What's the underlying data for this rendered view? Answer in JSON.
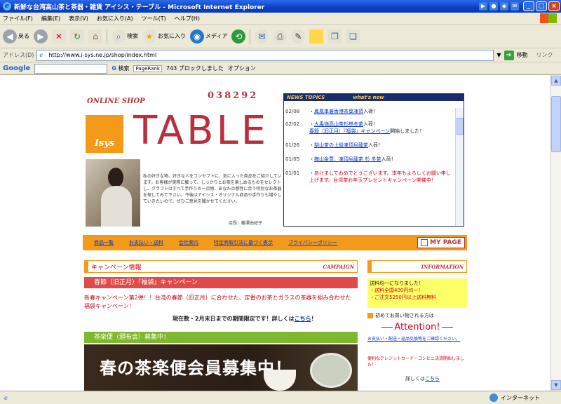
{
  "window": {
    "title": "新鮮な台湾高山茶と茶器・雑貨 アイシス・テーブル - Microsoft Internet Explorer"
  },
  "menu": [
    "ファイル(F)",
    "編集(E)",
    "表示(V)",
    "お気に入り(A)",
    "ツール(T)",
    "ヘルプ(H)"
  ],
  "toolbar": {
    "back": "戻る",
    "search": "検索",
    "favorites": "お気に入り",
    "media": "メディア"
  },
  "address": {
    "label": "アドレス(D)",
    "url": "http://www.i-sys.ne.jp/shop/index.html",
    "go": "移動",
    "links": "リンク"
  },
  "google": {
    "logo": "Google",
    "search_btn": "検索",
    "pagerank": "PageRank",
    "blocked": "743 ブロックしました",
    "options": "オプション"
  },
  "site": {
    "online_shop": "ONLINE SHOP",
    "counter": "038292",
    "logo_text": "Isys",
    "table_word": "TABLE",
    "intro": "私の好きな物、好きな人をコンセプトに、気に入った商品をご紹介しています。お客様が実際に触って、しっかりとお茶を楽しめるものをセレクトし、クラフトはすべて手作りの一点物、あなたの感性に合う特別なお茶器を探してみて下さい。今後はアイシス・オリジナル商品や手作りも増やしていきたいので、ぜひご意見を聞かせてください。",
    "sign": "店長：藤澤由紀子",
    "news_header_jp": "NEWS TOPICS",
    "news_header_en": "what's new",
    "news": [
      {
        "date": "02/08",
        "pre": "・",
        "link": "鳳凰単叢香港茶葉凍頂",
        "post": "入荷！"
      },
      {
        "date": "02/02",
        "pre": "・",
        "link": "大禹嶺高山茶杉林冬茶",
        "post": "入荷！",
        "link2": "春節（旧正月）『福袋』キャンペーン",
        "post2": "開始しました！"
      },
      {
        "date": "01/26",
        "pre": "・",
        "link": "梨山茶の上級凍頂烏龍茶",
        "post": "入荷！"
      },
      {
        "date": "01/05",
        "pre": "・",
        "link": "梅山金萱、凍頂烏龍茶 杉 冬茶",
        "post": "入荷！"
      },
      {
        "date": "01/01",
        "pre": "・",
        "red": "あけましておめでとうございます。本年もよろしくお願い申し上げます。台湾茶お年玉プレゼントキャンペーン開催中！"
      }
    ],
    "nav": [
      "商品一覧",
      "お支払い・送料",
      "会社案内",
      "特定商取引法に基づく表示",
      "プライバシーポリシー"
    ],
    "mypage": "MY PAGE",
    "campaign_jp": "キャンペーン情報",
    "campaign_en": "CAMPAIGN",
    "campaign_bar": "春節（旧正月）『福袋』キャンペーン",
    "campaign_text": "新春キャンペーン第2弾！！台湾の春節（旧正月）に合わせた、定番のお茶とガラスの茶器を組み合わせた福袋キャンペーン！",
    "campaign_note": "現在数・2月末日までの期間限定です！詳しくは",
    "campaign_link": "こちら",
    "campaign_tail": "！",
    "teabin_bar": "茶楽便（頒布会）募集中！",
    "banner_text": "春の茶楽便会員募集中！",
    "info_en": "INFORMATION",
    "info_yellow_line1": "送料均一になりました！",
    "info_yellow_line2": "・送料全国400円均一！",
    "info_yellow_line3": "・ご注文5250円以上送料無料",
    "info_first": "初めてお買い物される方は",
    "attention": "Attention!",
    "info_links": "お支払い・配送・返品交換等をご確認ください。",
    "info_credit": "便利なクレジットカード・コンビニ決済開始しました！",
    "info_more": "詳しくは",
    "info_more_link": "こちら"
  },
  "status": {
    "zone": "インターネット"
  }
}
